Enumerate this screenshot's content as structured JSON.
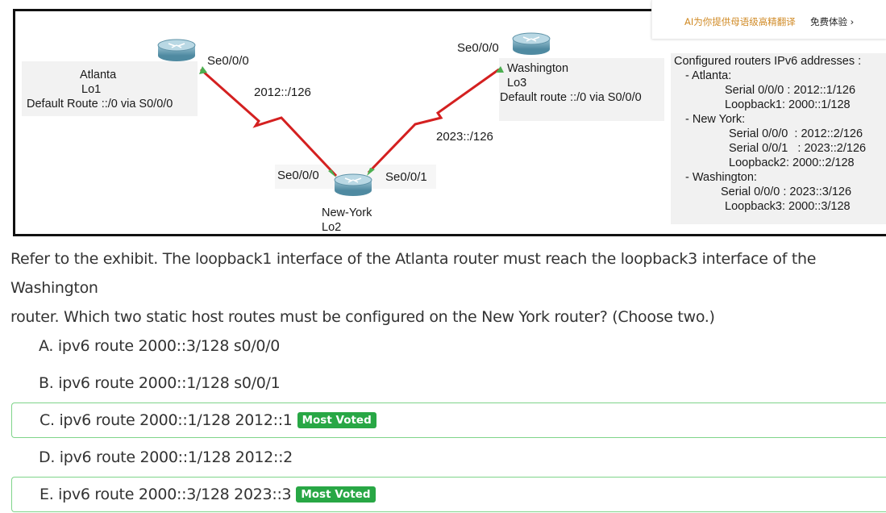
{
  "translate_bar": {
    "text": "AI为你提供母语级高精翻译",
    "button": "免费体验 ›"
  },
  "exhibit": {
    "atlanta": {
      "name": "Atlanta",
      "lo": "Lo1",
      "route": "Default Route ::/0 via S0/0/0",
      "iface": "Se0/0/0"
    },
    "washington": {
      "name": "Washington",
      "lo": "Lo3",
      "route": "Default route ::/0 via S0/0/0",
      "iface": "Se0/0/0"
    },
    "newyork": {
      "name": "New-York",
      "lo": "Lo2",
      "iface_left": "Se0/0/0",
      "iface_right": "Se0/0/1"
    },
    "link_left": "2012::/126",
    "link_right": "2023::/126",
    "config": {
      "title": "Configured routers IPv6 addresses :",
      "atlanta_hdr": "- Atlanta:",
      "atlanta_s000": "Serial 0/0/0 : 2012::1/126",
      "atlanta_lb1": "Loopback1: 2000::1/128",
      "ny_hdr": "- New York:",
      "ny_s000": "Serial 0/0/0  : 2012::2/126",
      "ny_s001": "Serial 0/0/1   : 2023::2/126",
      "ny_lb2": "Loopback2: 2000::2/128",
      "wash_hdr": "- Washington:",
      "wash_s000": "Serial 0/0/0 : 2023::3/126",
      "wash_lb3": "Loopback3: 2000::3/128"
    }
  },
  "question": {
    "line1": "Refer to the exhibit. The loopback1 interface of the Atlanta router must reach the loopback3 interface of the Washington",
    "line2": "router. Which two static host routes must be configured on the New York router? (Choose two.)"
  },
  "options": [
    {
      "text": "A. ipv6 route 2000::3/128 s0/0/0",
      "badge": ""
    },
    {
      "text": "B. ipv6 route 2000::1/128 s0/0/1",
      "badge": ""
    },
    {
      "text": "C. ipv6 route 2000::1/128 2012::1",
      "badge": "Most Voted"
    },
    {
      "text": "D. ipv6 route 2000::1/128 2012::2",
      "badge": ""
    },
    {
      "text": "E. ipv6 route 2000::3/128 2023::3",
      "badge": "Most Voted"
    }
  ],
  "colors": {
    "link": "#d42020",
    "badge": "#28a745",
    "voted_border": "#7fd48a",
    "router": "#6fa3b8"
  }
}
